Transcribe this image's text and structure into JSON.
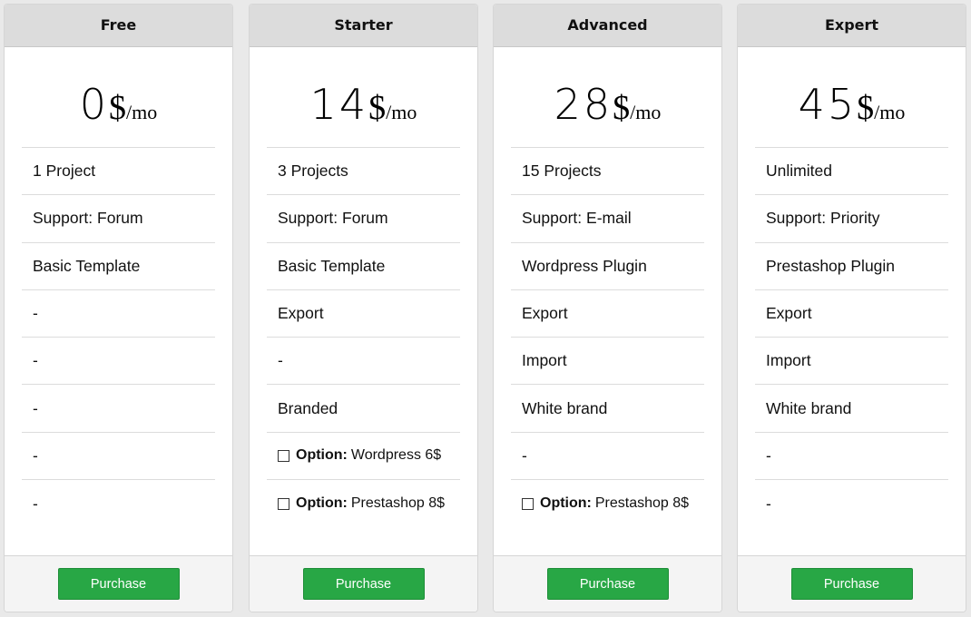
{
  "colors": {
    "page_background": "#e9e9e9",
    "header_background": "#dcdcdc",
    "card_background": "#ffffff",
    "footer_background": "#f4f4f4",
    "button_background": "#28a745",
    "button_text": "#ffffff"
  },
  "plans": [
    {
      "name": "Free",
      "price": {
        "amount": "0",
        "currency": "$",
        "unit": "/mo"
      },
      "features": [
        "1 Project",
        "Support: Forum",
        "Basic Template",
        "-",
        "-",
        "-",
        "-",
        "-"
      ],
      "purchase_label": "Purchase"
    },
    {
      "name": "Starter",
      "price": {
        "amount": "14",
        "currency": "$",
        "unit": "/mo"
      },
      "features": [
        "3 Projects",
        "Support: Forum",
        "Basic Template",
        "Export",
        "-",
        "Branded"
      ],
      "options": [
        {
          "label": "Option:",
          "value": "Wordpress 6$",
          "checked": false
        },
        {
          "label": "Option:",
          "value": "Prestashop 8$",
          "checked": false
        }
      ],
      "purchase_label": "Purchase"
    },
    {
      "name": "Advanced",
      "price": {
        "amount": "28",
        "currency": "$",
        "unit": "/mo"
      },
      "features": [
        "15 Projects",
        "Support: E-mail",
        "Wordpress Plugin",
        "Export",
        "Import",
        "White brand",
        "-"
      ],
      "options": [
        {
          "label": "Option:",
          "value": "Prestashop 8$",
          "checked": false
        }
      ],
      "purchase_label": "Purchase"
    },
    {
      "name": "Expert",
      "price": {
        "amount": "45",
        "currency": "$",
        "unit": "/mo"
      },
      "features": [
        "Unlimited",
        "Support: Priority",
        "Prestashop Plugin",
        "Export",
        "Import",
        "White brand",
        "-",
        "-"
      ],
      "purchase_label": "Purchase"
    }
  ]
}
